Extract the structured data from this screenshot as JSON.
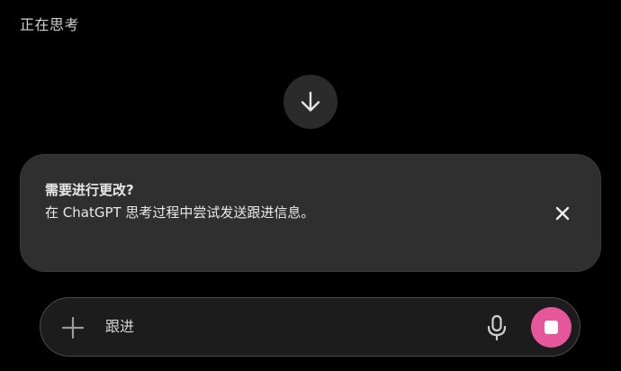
{
  "status": {
    "text": "正在思考"
  },
  "scroll_button": {
    "icon": "arrow-down-icon"
  },
  "notice": {
    "title": "需要进行更改?",
    "body": "在 ChatGPT 思考过程中尝试发送跟进信息。",
    "close_icon": "close-icon"
  },
  "composer": {
    "placeholder": "跟进",
    "add_icon": "plus-icon",
    "mic_icon": "microphone-icon",
    "stop_icon": "stop-icon",
    "stop_color": "#e5569a"
  },
  "colors": {
    "background": "#000000",
    "card": "#2f2f2f",
    "accent": "#e5569a"
  }
}
